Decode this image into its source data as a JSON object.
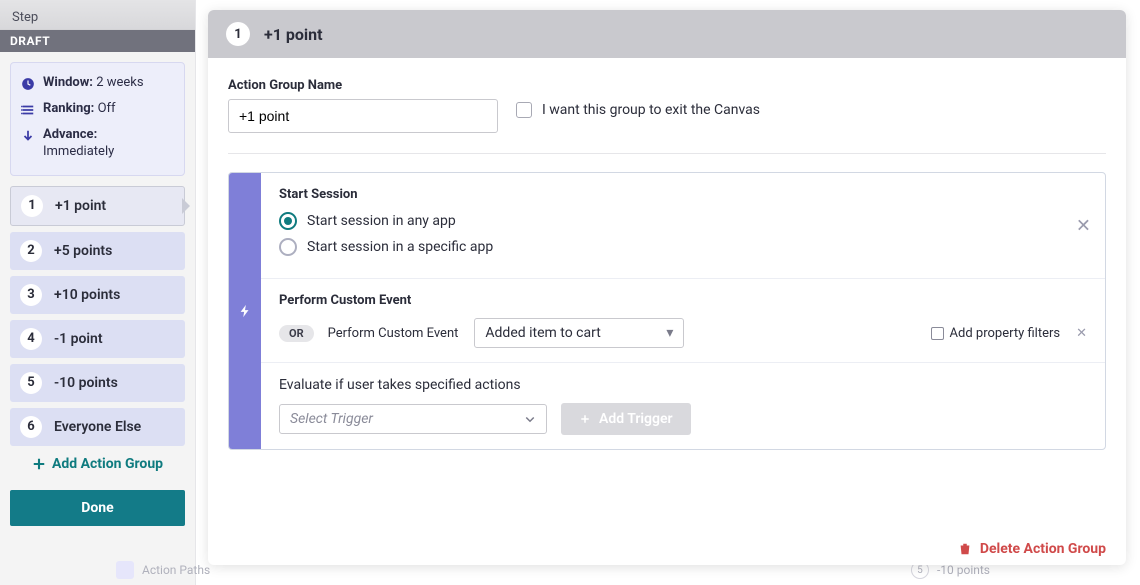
{
  "sidebar": {
    "step_label": "Step",
    "status": "DRAFT",
    "meta": {
      "window_label": "Window:",
      "window_value": "2 weeks",
      "ranking_label": "Ranking:",
      "ranking_value": "Off",
      "advance_label": "Advance:",
      "advance_value": "Immediately"
    },
    "groups": [
      {
        "n": "1",
        "label": "+1 point"
      },
      {
        "n": "2",
        "label": "+5 points"
      },
      {
        "n": "3",
        "label": "+10 points"
      },
      {
        "n": "4",
        "label": "-1 point"
      },
      {
        "n": "5",
        "label": "-10 points"
      },
      {
        "n": "6",
        "label": "Everyone Else"
      }
    ],
    "selected_index": 0,
    "add_group_label": "Add Action Group",
    "done_label": "Done"
  },
  "panel": {
    "header_number": "1",
    "header_title": "+1 point",
    "action_group_name_label": "Action Group Name",
    "action_group_name_value": "+1 point",
    "exit_canvas_label": "I want this group to exit the Canvas",
    "card": {
      "start_session_title": "Start Session",
      "radio_any": "Start session in any app",
      "radio_specific": "Start session in a specific app",
      "radio_selected": "any",
      "custom_event_title": "Perform Custom Event",
      "or_label": "OR",
      "perform_label": "Perform Custom Event",
      "event_select_value": "Added item to cart",
      "property_filter_label": "Add property filters",
      "evaluate_label": "Evaluate if user takes specified actions",
      "select_trigger_placeholder": "Select Trigger",
      "add_trigger_label": "Add Trigger"
    },
    "delete_label": "Delete Action Group"
  },
  "background": {
    "action_paths_label": "Action Paths",
    "row5_n": "5",
    "row5_label": "-10 points"
  }
}
